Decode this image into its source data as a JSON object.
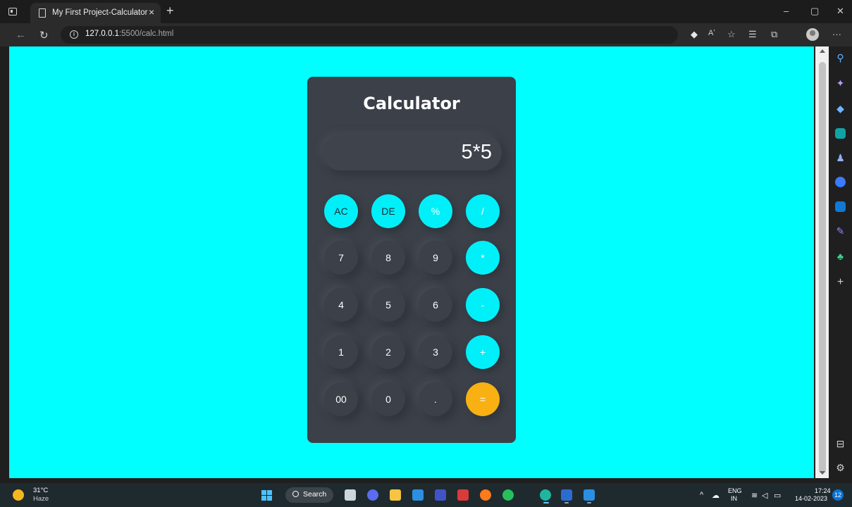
{
  "browser": {
    "tab_title": "My First Project-Calculator",
    "tab_close": "×",
    "new_tab": "+",
    "window_minimize": "–",
    "window_restore": "▢",
    "window_close": "✕",
    "url_host": "127.0.0.1",
    "url_path": ":5500/calc.html",
    "info_glyph": "i",
    "more_glyph": "···",
    "read_aloud_glyph": "Aʼ"
  },
  "sidebar": {
    "icons": [
      "search-icon",
      "copilot-icon",
      "shopping-tag-icon",
      "tools-briefcase-icon",
      "games-icon",
      "microsoft-365-icon",
      "outlook-icon",
      "drop-icon",
      "tree-icon",
      "add-icon",
      "split-screen-icon",
      "settings-icon"
    ]
  },
  "calculator": {
    "title": "Calculator",
    "display": "5*5",
    "rows": [
      [
        "AC",
        "DE",
        "%",
        "/"
      ],
      [
        "7",
        "8",
        "9",
        "*"
      ],
      [
        "4",
        "5",
        "6",
        "-"
      ],
      [
        "1",
        "2",
        "3",
        "+"
      ],
      [
        "00",
        "0",
        ".",
        "="
      ]
    ],
    "colors": {
      "panel": "#3b4049",
      "accent": "#00f0fa",
      "equals": "#f8b012",
      "page_bg": "#00ffff"
    }
  },
  "taskbar": {
    "weather_temp": "31°C",
    "weather_cond": "Haze",
    "search_label": "Search",
    "lang_top": "ENG",
    "lang_bottom": "IN",
    "time": "17:24",
    "date": "14-02-2023",
    "notifications": "12"
  }
}
